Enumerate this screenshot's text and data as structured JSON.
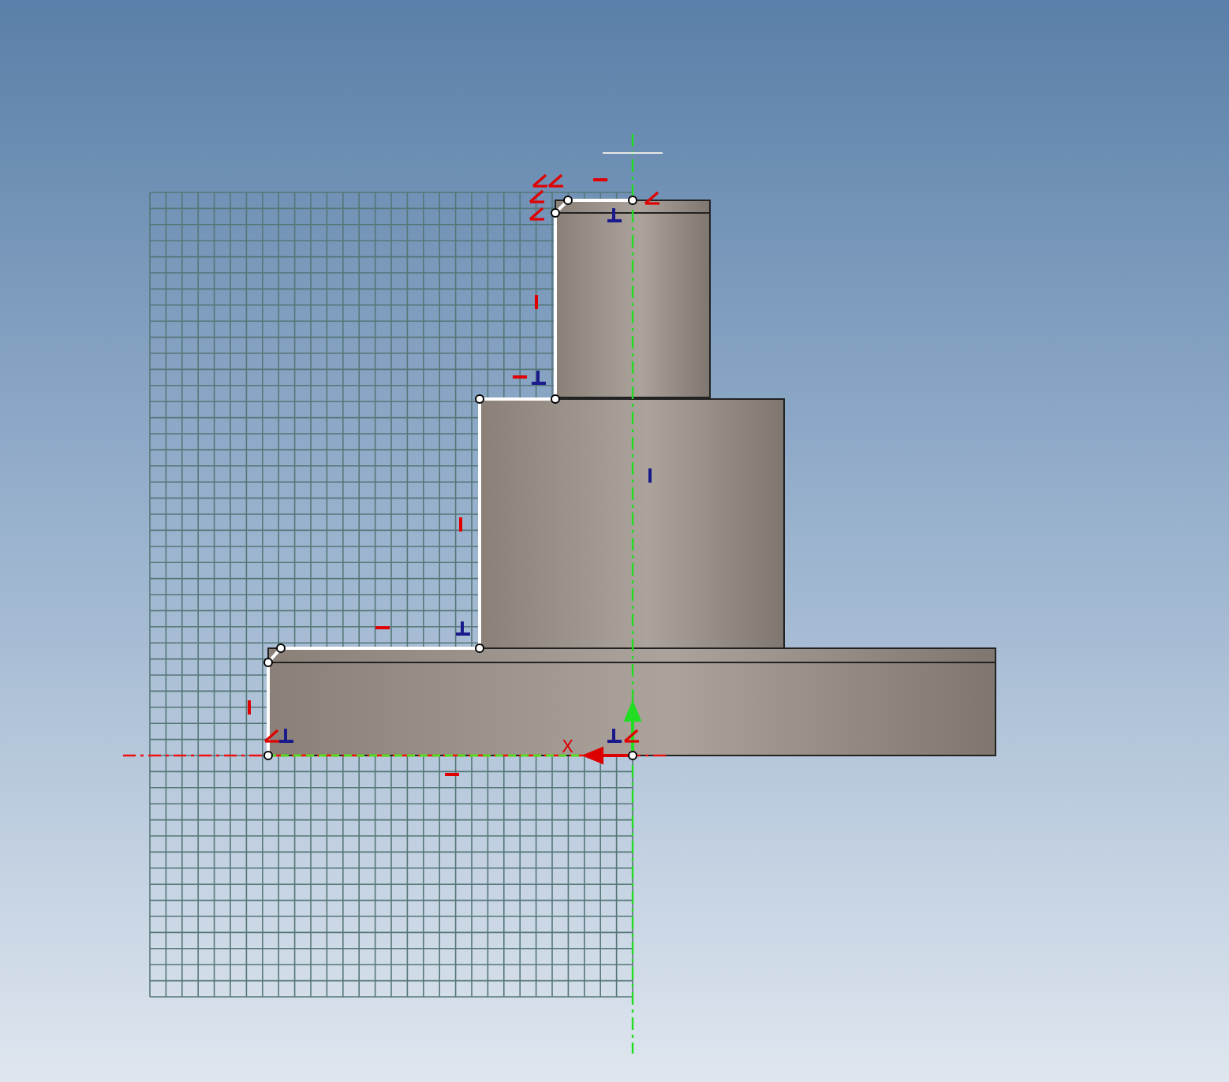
{
  "viewport": {
    "axis_label": "X"
  }
}
